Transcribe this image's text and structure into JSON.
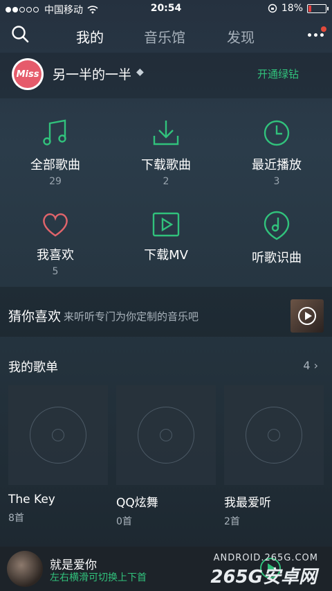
{
  "status": {
    "carrier": "中国移动",
    "time": "20:54",
    "battery": "18%",
    "battery_level": 0.18
  },
  "nav": {
    "tabs": [
      "我的",
      "音乐馆",
      "发现"
    ]
  },
  "user": {
    "name": "另一半的一半",
    "avatar_text": "Miss",
    "vip_label": "开通绿钻"
  },
  "grid": [
    {
      "label": "全部歌曲",
      "count": "29",
      "icon": "music-note-icon"
    },
    {
      "label": "下载歌曲",
      "count": "2",
      "icon": "download-icon"
    },
    {
      "label": "最近播放",
      "count": "3",
      "icon": "clock-icon"
    },
    {
      "label": "我喜欢",
      "count": "5",
      "icon": "heart-icon"
    },
    {
      "label": "下载MV",
      "count": "",
      "icon": "video-play-icon"
    },
    {
      "label": "听歌识曲",
      "count": "",
      "icon": "recognize-music-icon"
    }
  ],
  "guess": {
    "title": "猜你喜欢",
    "subtitle": "来听听专门为你定制的音乐吧"
  },
  "playlists": {
    "header": "我的歌单",
    "count": "4 ›",
    "items": [
      {
        "name": "The Key",
        "count": "8首"
      },
      {
        "name": "QQ炫舞",
        "count": "0首"
      },
      {
        "name": "我最爱听",
        "count": "2首"
      }
    ]
  },
  "player": {
    "title": "就是爱你",
    "hint": "左右横滑可切换上下首"
  },
  "watermark": {
    "line1": "ANDROID.265G.COM",
    "line2": "265G安卓网"
  },
  "colors": {
    "accent": "#31c27c",
    "heart": "#e0646b",
    "notify": "#e24a3b"
  }
}
